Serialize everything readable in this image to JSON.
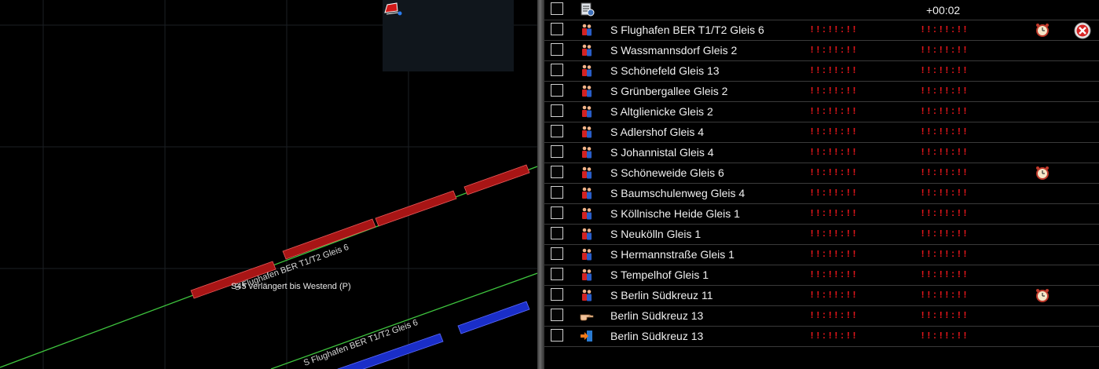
{
  "map": {
    "label_train_upper": "S Flughafen BER T1/T2 Gleis 6",
    "label_train_lower": "S Flughafen BER T1/T2 Gleis 6",
    "label_note": "S45 verlängert bis Westend (P)",
    "colors": {
      "track": "#3ec43e",
      "train_red": "#b01818",
      "train_blue": "#1a2ec8"
    }
  },
  "panel": {
    "header": {
      "time_offset": "+00:02"
    },
    "rows": [
      {
        "name": "S Flughafen BER T1/T2 Gleis 6",
        "t1": "!!:!!:!!",
        "t2": "!!:!!:!!",
        "icon": "passengers-icon",
        "clock": true,
        "cancel": true
      },
      {
        "name": "S Wassmannsdorf Gleis 2",
        "t1": "!!:!!:!!",
        "t2": "!!:!!:!!",
        "icon": "passengers-icon"
      },
      {
        "name": "S Schönefeld Gleis 13",
        "t1": "!!:!!:!!",
        "t2": "!!:!!:!!",
        "icon": "passengers-icon"
      },
      {
        "name": "S Grünbergallee Gleis 2",
        "t1": "!!:!!:!!",
        "t2": "!!:!!:!!",
        "icon": "passengers-icon"
      },
      {
        "name": "S Altglienicke Gleis 2",
        "t1": "!!:!!:!!",
        "t2": "!!:!!:!!",
        "icon": "passengers-icon"
      },
      {
        "name": "S Adlershof Gleis 4",
        "t1": "!!:!!:!!",
        "t2": "!!:!!:!!",
        "icon": "passengers-icon"
      },
      {
        "name": "S Johannistal Gleis 4",
        "t1": "!!:!!:!!",
        "t2": "!!:!!:!!",
        "icon": "passengers-icon"
      },
      {
        "name": "S Schöneweide Gleis 6",
        "t1": "!!:!!:!!",
        "t2": "!!:!!:!!",
        "icon": "passengers-icon",
        "clock": true
      },
      {
        "name": "S Baumschulenweg Gleis 4",
        "t1": "!!:!!:!!",
        "t2": "!!:!!:!!",
        "icon": "passengers-icon"
      },
      {
        "name": "S Köllnische Heide Gleis 1",
        "t1": "!!:!!:!!",
        "t2": "!!:!!:!!",
        "icon": "passengers-icon"
      },
      {
        "name": "S Neukölln Gleis 1",
        "t1": "!!:!!:!!",
        "t2": "!!:!!:!!",
        "icon": "passengers-icon"
      },
      {
        "name": "S Hermannstraße Gleis 1",
        "t1": "!!:!!:!!",
        "t2": "!!:!!:!!",
        "icon": "passengers-icon"
      },
      {
        "name": "S Tempelhof Gleis 1",
        "t1": "!!:!!:!!",
        "t2": "!!:!!:!!",
        "icon": "passengers-icon"
      },
      {
        "name": "S Berlin Südkreuz 11",
        "t1": "!!:!!:!!",
        "t2": "!!:!!:!!",
        "icon": "passengers-icon",
        "clock": true
      },
      {
        "name": "Berlin Südkreuz 13",
        "t1": "!!:!!:!!",
        "t2": "!!:!!:!!",
        "icon": "pointing-hand-icon"
      },
      {
        "name": "Berlin Südkreuz 13",
        "t1": "!!:!!:!!",
        "t2": "!!:!!:!!",
        "icon": "enter-arrow-icon"
      }
    ]
  }
}
